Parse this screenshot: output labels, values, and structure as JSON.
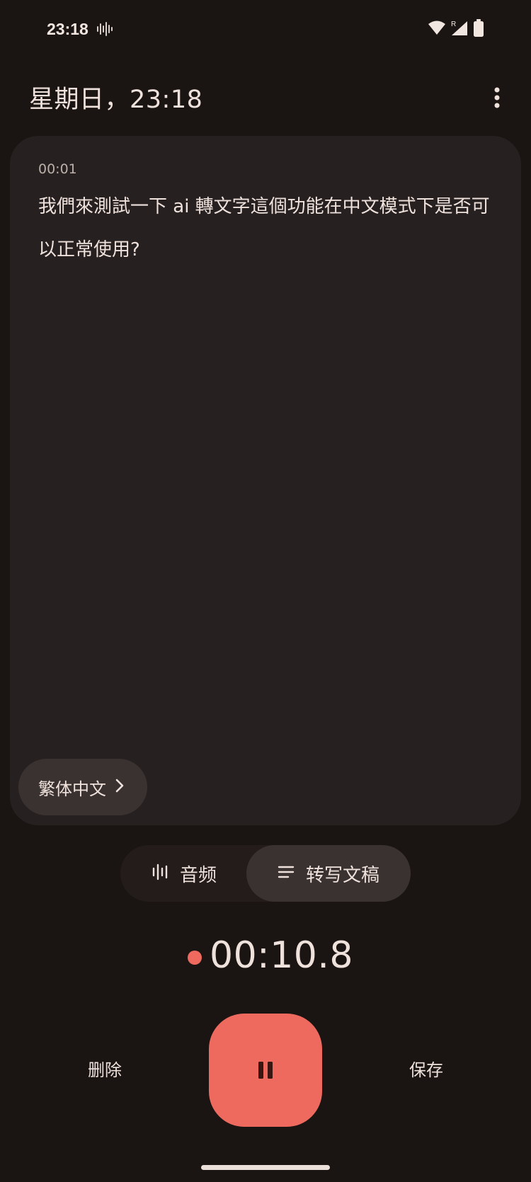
{
  "status_bar": {
    "time": "23:18",
    "icons": [
      "waveform-icon",
      "wifi-icon",
      "signal-icon",
      "battery-icon"
    ],
    "roaming_marker": "R"
  },
  "header": {
    "title": "星期日，23:18",
    "menu_icon": "more-vert-icon"
  },
  "transcript": {
    "segments": [
      {
        "time": "00:01",
        "text": "我們來測試一下 ai 轉文字這個功能在中文模式下是否可以正常使用?"
      }
    ],
    "language_chip": "繁体中文"
  },
  "view_toggle": {
    "audio_label": "音频",
    "transcript_label": "转写文稿",
    "selected": "transcript"
  },
  "recording": {
    "elapsed": "00:10.8",
    "state": "recording"
  },
  "controls": {
    "delete_label": "删除",
    "save_label": "保存",
    "pause_icon": "pause-icon"
  },
  "colors": {
    "background": "#1a1412",
    "card": "#262020",
    "accent": "#ee6a5e",
    "chip": "#3a3230",
    "text": "#efe2dc"
  }
}
